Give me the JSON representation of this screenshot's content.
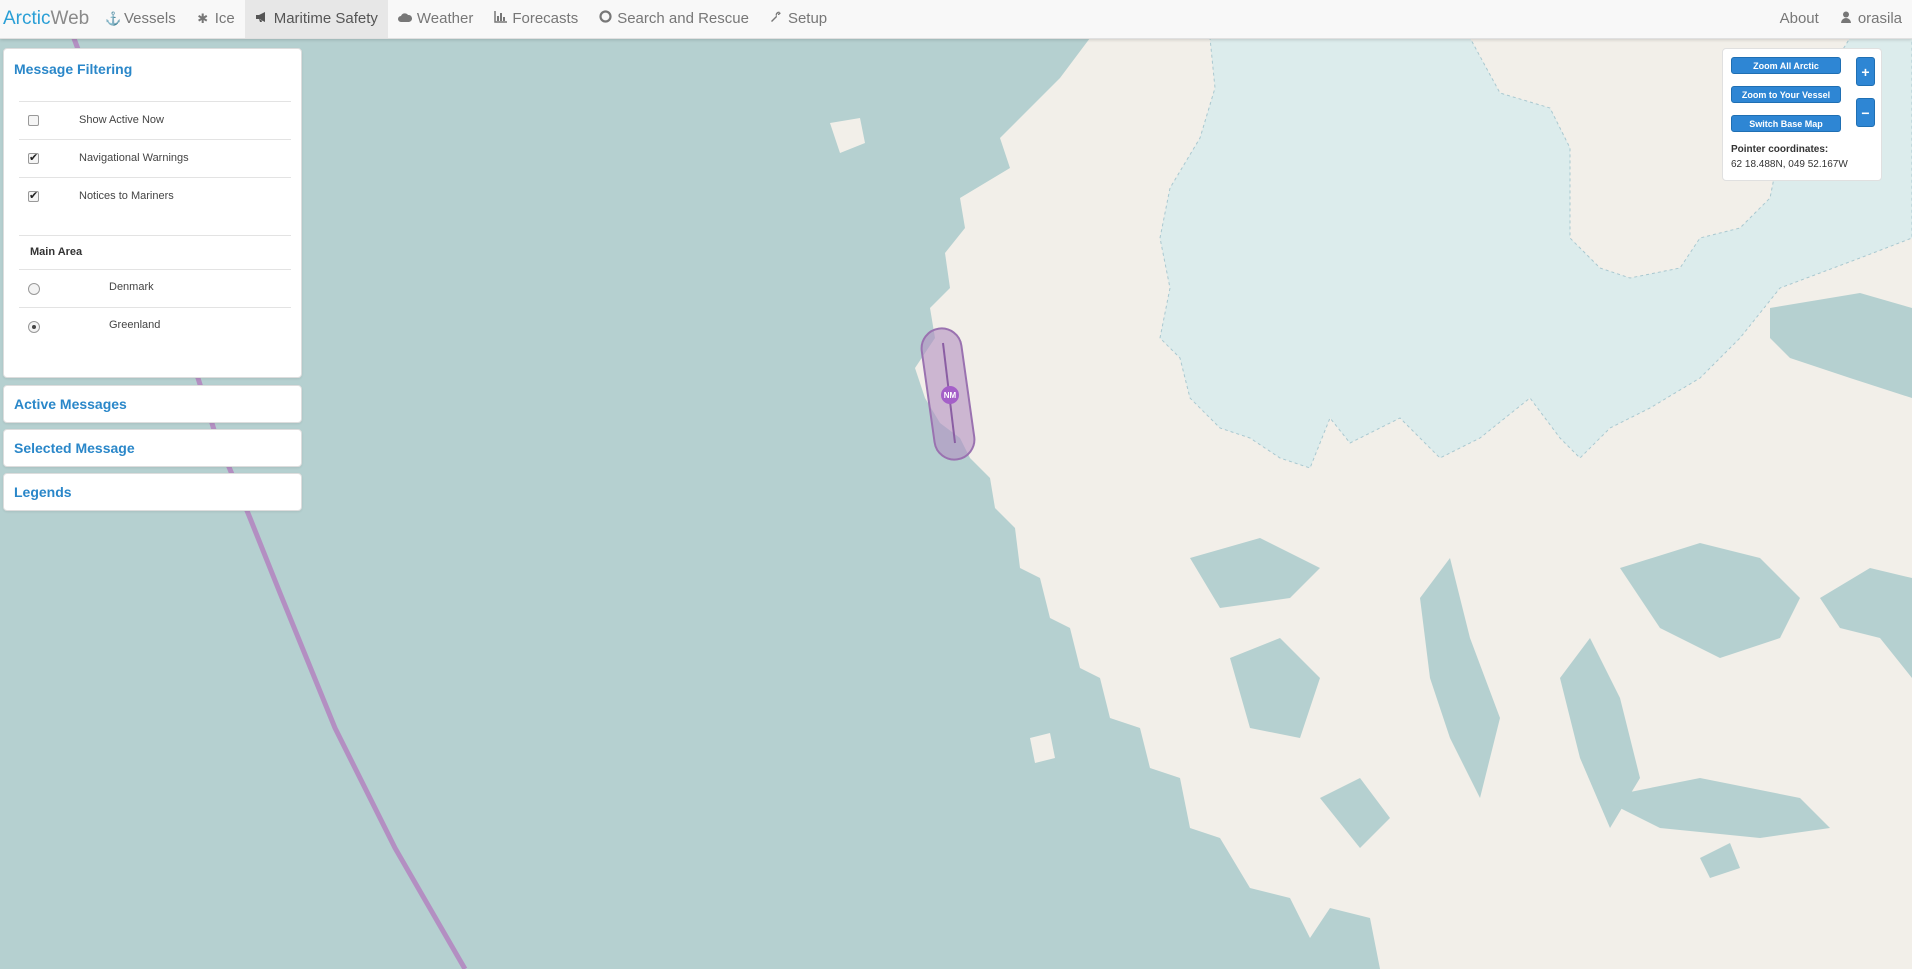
{
  "navbar": {
    "brand_part1": "Arctic",
    "brand_part2": "Web",
    "items": [
      {
        "label": "Vessels",
        "icon": "anchor-icon"
      },
      {
        "label": "Ice",
        "icon": "asterisk-icon"
      },
      {
        "label": "Maritime Safety",
        "icon": "bullhorn-icon",
        "active": true
      },
      {
        "label": "Weather",
        "icon": "cloud-icon"
      },
      {
        "label": "Forecasts",
        "icon": "chart-icon"
      },
      {
        "label": "Search and Rescue",
        "icon": "life-ring-icon"
      },
      {
        "label": "Setup",
        "icon": "wrench-icon"
      }
    ],
    "about": "About",
    "user": "orasila",
    "user_icon": "user-icon"
  },
  "filtering": {
    "title": "Message Filtering",
    "options": [
      {
        "label": "Show Active Now",
        "checked": false
      },
      {
        "label": "Navigational Warnings",
        "checked": true
      },
      {
        "label": "Notices to Mariners",
        "checked": true
      }
    ],
    "main_area_label": "Main Area",
    "areas": [
      {
        "label": "Denmark",
        "selected": false
      },
      {
        "label": "Greenland",
        "selected": true
      }
    ]
  },
  "panels": {
    "active_messages": "Active Messages",
    "selected_message": "Selected Message",
    "legends": "Legends"
  },
  "map_controls": {
    "zoom_all": "Zoom All Arctic",
    "zoom_vessel": "Zoom to Your Vessel",
    "switch_base": "Switch Base Map",
    "pointer_label": "Pointer coordinates:",
    "pointer_value": "62 18.488N, 049 52.167W",
    "zoom_in": "+",
    "zoom_out": "−"
  },
  "map": {
    "marker_label": "NM",
    "colors": {
      "sea": "#b5d0d0",
      "land": "#f2efe9",
      "ice": "#dcecec",
      "route": "#b38fc2",
      "marker": "#a45fc8"
    }
  }
}
